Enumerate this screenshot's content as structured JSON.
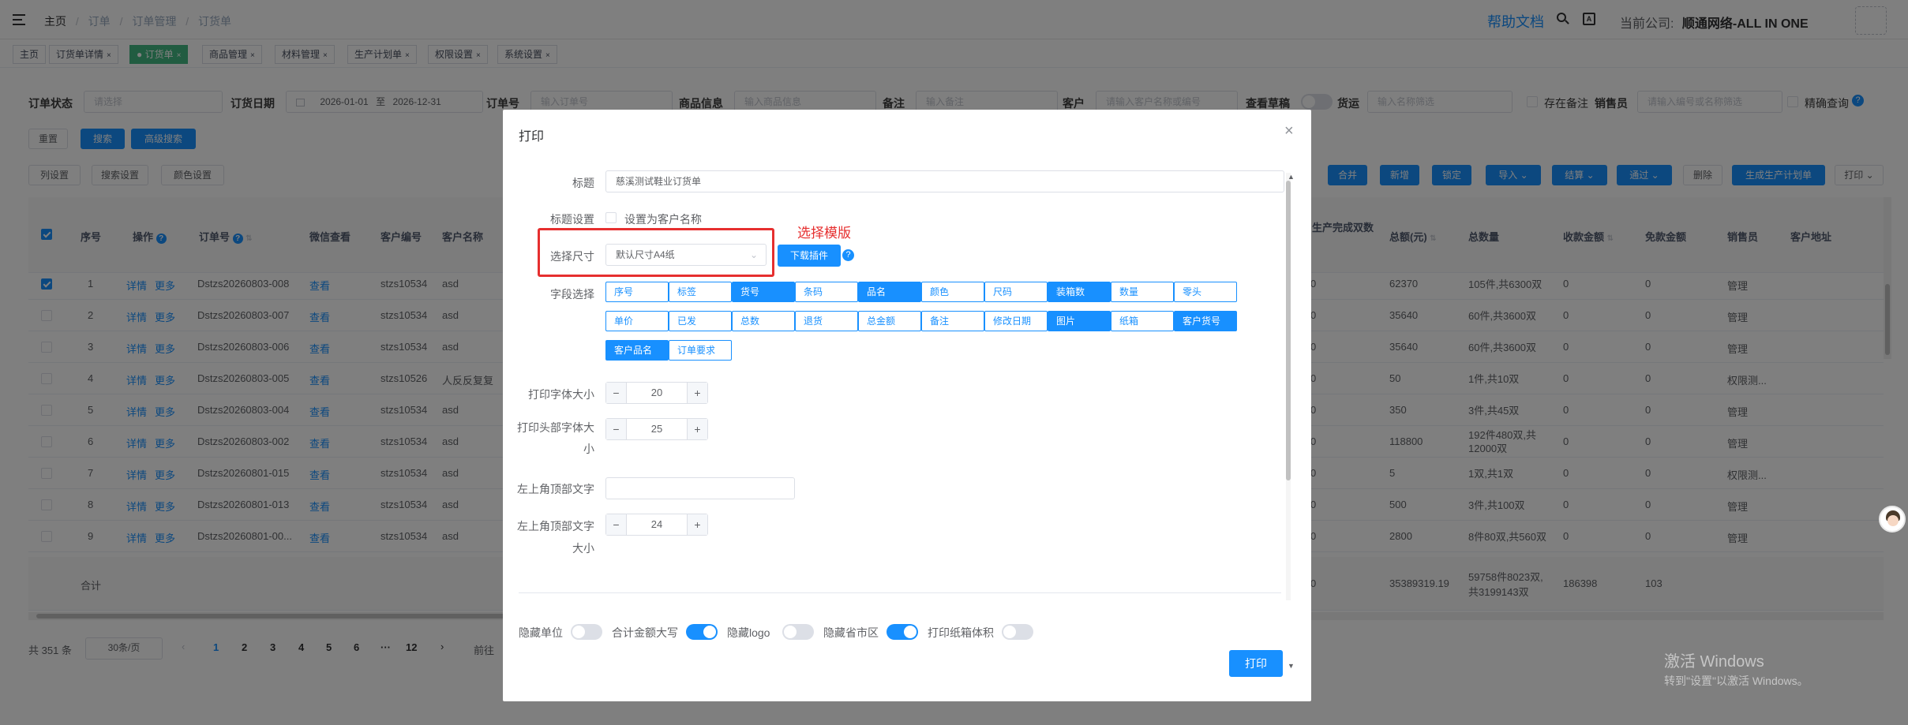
{
  "topbar": {
    "breadcrumb": [
      "主页",
      "订单",
      "订单管理",
      "订货单"
    ],
    "help": "帮助文档",
    "company_label": "当前公司:",
    "company": "顺通网络-ALL IN ONE"
  },
  "tabs": [
    {
      "label": "主页"
    },
    {
      "label": "订货单详情"
    },
    {
      "label": "订货单"
    },
    {
      "label": "商品管理"
    },
    {
      "label": "材料管理"
    },
    {
      "label": "生产计划单"
    },
    {
      "label": "权限设置"
    },
    {
      "label": "系统设置"
    }
  ],
  "filters": {
    "status_label": "订单状态",
    "status_placeholder": "请选择",
    "date_label": "订货日期",
    "date_from": "2026-01-01",
    "date_sep": "至",
    "date_to": "2026-12-31",
    "order_label": "订单号",
    "order_placeholder": "输入订单号",
    "goods_label": "商品信息",
    "goods_placeholder": "输入商品信息",
    "remark_label": "备注",
    "remark_placeholder": "输入备注",
    "customer_label": "客户",
    "customer_placeholder": "请输入客户名称或编号",
    "draft_label": "查看草稿",
    "shipping_label": "货运",
    "shipping_placeholder": "输入名称筛选",
    "has_remark_label": "存在备注",
    "sales_label": "销售员",
    "sales_placeholder": "请输入编号或名称筛选",
    "exact_label": "精确查询"
  },
  "buttons": {
    "reset": "重置",
    "search": "搜索",
    "advanced": "高级搜索",
    "col_settings": "列设置",
    "search_settings": "搜索设置",
    "color_settings": "颜色设置",
    "merge": "合并",
    "add": "新增",
    "lock": "锁定",
    "import": "导入",
    "settle": "结算",
    "approve": "通过",
    "delete": "删除",
    "gen_plan": "生成生产计划单",
    "print": "打印"
  },
  "table": {
    "headers": {
      "index": "序号",
      "op": "操作",
      "order_no": "订单号",
      "wechat": "微信查看",
      "cust_no": "客户编号",
      "cust_name": "客户名称",
      "done_qty": "生产完成双数",
      "amount": "总额(元)",
      "total_qty": "总数量",
      "received": "收款金额",
      "free": "免款金额",
      "sales": "销售员",
      "address": "客户地址"
    },
    "detail": "详情",
    "more": "更多",
    "view": "查看",
    "rows": [
      {
        "i": "1",
        "order": "Dstzs20260803-008",
        "cno": "stzs10534",
        "cname": "asd",
        "done": "0",
        "amount": "62370",
        "qty": "105件,共6300双",
        "recv": "0",
        "free": "0",
        "sales": "管理",
        "checked": true
      },
      {
        "i": "2",
        "order": "Dstzs20260803-007",
        "cno": "stzs10534",
        "cname": "asd",
        "done": "0",
        "amount": "35640",
        "qty": "60件,共3600双",
        "recv": "0",
        "free": "0",
        "sales": "管理",
        "checked": false
      },
      {
        "i": "3",
        "order": "Dstzs20260803-006",
        "cno": "stzs10534",
        "cname": "asd",
        "done": "0",
        "amount": "35640",
        "qty": "60件,共3600双",
        "recv": "0",
        "free": "0",
        "sales": "管理",
        "checked": false
      },
      {
        "i": "4",
        "order": "Dstzs20260803-005",
        "cno": "stzs10526",
        "cname": "人反反复复",
        "done": "0",
        "amount": "50",
        "qty": "1件,共10双",
        "recv": "0",
        "free": "0",
        "sales": "权限测...",
        "checked": false
      },
      {
        "i": "5",
        "order": "Dstzs20260803-004",
        "cno": "stzs10534",
        "cname": "asd",
        "done": "0",
        "amount": "350",
        "qty": "3件,共45双",
        "recv": "0",
        "free": "0",
        "sales": "管理",
        "checked": false
      },
      {
        "i": "6",
        "order": "Dstzs20260803-002",
        "cno": "stzs10534",
        "cname": "asd",
        "done": "0",
        "amount": "118800",
        "qty": "192件480双,共12000双",
        "recv": "0",
        "free": "0",
        "sales": "管理",
        "checked": false
      },
      {
        "i": "7",
        "order": "Dstzs20260801-015",
        "cno": "stzs10534",
        "cname": "asd",
        "done": "0",
        "amount": "5",
        "qty": "1双,共1双",
        "recv": "0",
        "free": "0",
        "sales": "权限测...",
        "checked": false
      },
      {
        "i": "8",
        "order": "Dstzs20260801-013",
        "cno": "stzs10534",
        "cname": "asd",
        "done": "0",
        "amount": "500",
        "qty": "3件,共100双",
        "recv": "0",
        "free": "0",
        "sales": "管理",
        "checked": false
      },
      {
        "i": "9",
        "order": "Dstzs20260801-00...",
        "cno": "stzs10534",
        "cname": "asd",
        "done": "0",
        "amount": "2800",
        "qty": "8件80双,共560双",
        "recv": "0",
        "free": "0",
        "sales": "管理",
        "checked": false
      }
    ],
    "total": {
      "label": "合计",
      "done": "0",
      "amount": "35389319.19",
      "qty": "59758件8023双,共3199143双",
      "recv": "186398",
      "free": "103"
    }
  },
  "pagination": {
    "total": "共 351 条",
    "page_size": "30条/页",
    "pages": [
      "1",
      "2",
      "3",
      "4",
      "5",
      "6",
      "···",
      "12"
    ],
    "goto": "前往"
  },
  "dialog": {
    "title": "打印",
    "title_label": "标题",
    "title_value": "慈溪测试鞋业订货单",
    "title_setting_label": "标题设置",
    "set_customer_name": "设置为客户名称",
    "size_label": "选择尺寸",
    "size_value": "默认尺寸A4纸",
    "download_plugin": "下载插件",
    "annotation": "选择模版",
    "field_label": "字段选择",
    "fields": [
      {
        "label": "序号",
        "on": false
      },
      {
        "label": "标签",
        "on": false
      },
      {
        "label": "货号",
        "on": true
      },
      {
        "label": "条码",
        "on": false
      },
      {
        "label": "品名",
        "on": true
      },
      {
        "label": "颜色",
        "on": false
      },
      {
        "label": "尺码",
        "on": false
      },
      {
        "label": "装箱数",
        "on": true
      },
      {
        "label": "数量",
        "on": false
      },
      {
        "label": "零头",
        "on": false
      },
      {
        "label": "单价",
        "on": false
      },
      {
        "label": "已发",
        "on": false
      },
      {
        "label": "总数",
        "on": false
      },
      {
        "label": "退货",
        "on": false
      },
      {
        "label": "总金额",
        "on": false
      },
      {
        "label": "备注",
        "on": false
      },
      {
        "label": "修改日期",
        "on": false
      },
      {
        "label": "图片",
        "on": true
      },
      {
        "label": "纸箱",
        "on": false
      },
      {
        "label": "客户货号",
        "on": true
      },
      {
        "label": "客户品名",
        "on": true
      },
      {
        "label": "订单要求",
        "on": false
      }
    ],
    "font_size_label": "打印字体大小",
    "font_size": "20",
    "head_font_label": "打印头部字体大小",
    "head_font_size": "25",
    "top_left_text_label": "左上角顶部文字",
    "top_left_size_label": "左上角顶部文字大小",
    "top_left_size": "24",
    "toggles": [
      {
        "label": "隐藏单位",
        "on": false
      },
      {
        "label": "合计金额大写",
        "on": true
      },
      {
        "label": "隐藏logo",
        "on": false
      },
      {
        "label": "隐藏省市区",
        "on": true
      },
      {
        "label": "打印纸箱体积",
        "on": false
      }
    ],
    "print": "打印"
  },
  "watermark": {
    "line1": "激活 Windows",
    "line2": "转到\"设置\"以激活 Windows。"
  }
}
